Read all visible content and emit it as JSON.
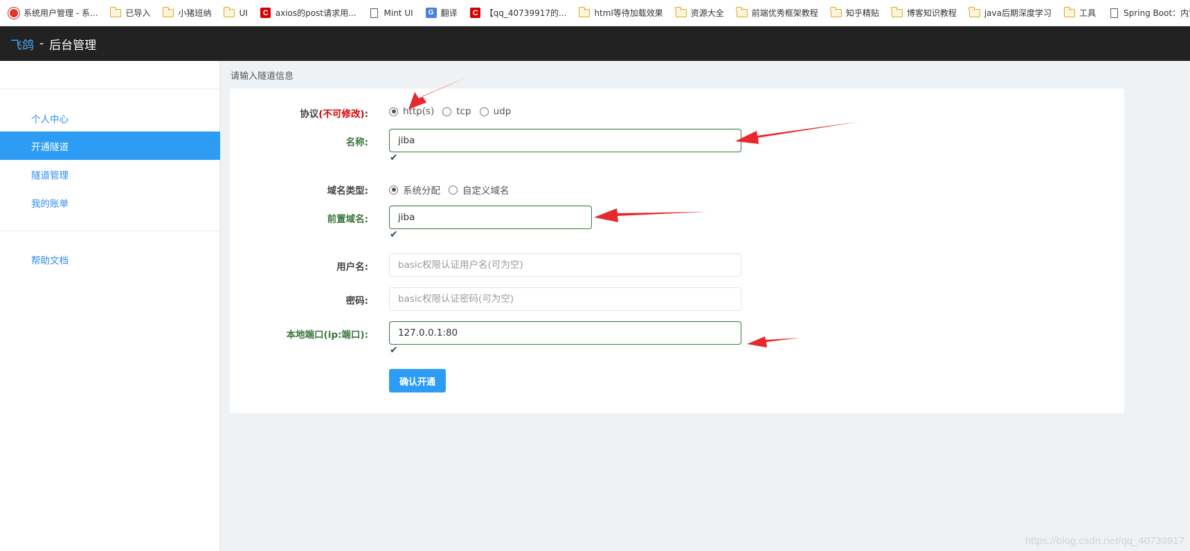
{
  "bookmarks": [
    {
      "label": "系统用户管理 - 系...",
      "icon": "app-icon"
    },
    {
      "label": "已导入",
      "icon": "folder-icon"
    },
    {
      "label": "小猪班纳",
      "icon": "folder-icon"
    },
    {
      "label": "UI",
      "icon": "folder-icon"
    },
    {
      "label": "axios的post请求用...",
      "icon": "csdn-icon"
    },
    {
      "label": "Mint UI",
      "icon": "page-icon"
    },
    {
      "label": "翻译",
      "icon": "translate-icon"
    },
    {
      "label": "【qq_40739917的...",
      "icon": "csdn-icon"
    },
    {
      "label": "html等待加载效果",
      "icon": "folder-icon"
    },
    {
      "label": "资源大全",
      "icon": "folder-icon"
    },
    {
      "label": "前端优秀框架教程",
      "icon": "folder-icon"
    },
    {
      "label": "知乎精贴",
      "icon": "folder-icon"
    },
    {
      "label": "博客知识教程",
      "icon": "folder-icon"
    },
    {
      "label": "java后期深度学习",
      "icon": "folder-icon"
    },
    {
      "label": "工具",
      "icon": "folder-icon"
    },
    {
      "label": "Spring Boot：内置",
      "icon": "page-icon"
    }
  ],
  "header": {
    "brand": "飞鸽",
    "separator": "-",
    "subtitle": "后台管理"
  },
  "sidebar": {
    "items": [
      {
        "label": "个人中心"
      },
      {
        "label": "开通隧道"
      },
      {
        "label": "隧道管理"
      },
      {
        "label": "我的账单"
      },
      {
        "label": "帮助文档"
      }
    ],
    "active": "开通隧道"
  },
  "main": {
    "section_title": "请输入隧道信息",
    "protocol": {
      "label": "协议",
      "label_note": "(不可修改)",
      "label_colon": ":",
      "options": [
        "http(s)",
        "tcp",
        "udp"
      ],
      "selected": "http(s)"
    },
    "name": {
      "label": "名称:",
      "value": "jiba"
    },
    "domain_type": {
      "label": "域名类型:",
      "options": [
        "系统分配",
        "自定义域名"
      ],
      "selected": "系统分配"
    },
    "prefix_domain": {
      "label": "前置域名:",
      "value": "jiba"
    },
    "username": {
      "label": "用户名:",
      "placeholder": "basic权限认证用户名(可为空)"
    },
    "password": {
      "label": "密码:",
      "placeholder": "basic权限认证密码(可为空)"
    },
    "local_port": {
      "label": "本地端口(ip:端口):",
      "value": "127.0.0.1:80"
    },
    "submit_label": "确认开通"
  },
  "watermark": "https://blog.csdn.net/qq_40739917",
  "colors": {
    "accent": "#2d9cf5",
    "header_bg": "#222222",
    "valid_green": "#3c763d",
    "required_red": "#d40000",
    "arrow_red": "#e8282c"
  }
}
